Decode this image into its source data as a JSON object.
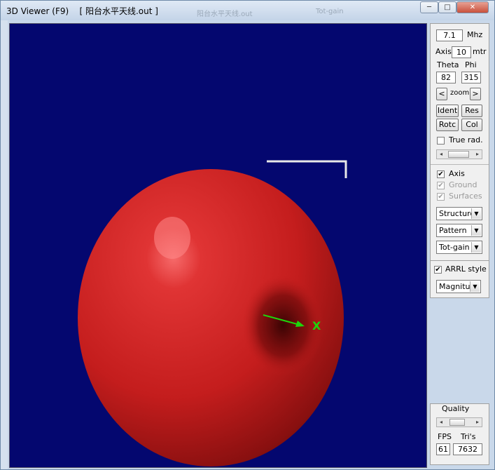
{
  "window": {
    "title": "3D Viewer (F9)    [ 阳台水平天线.out ]",
    "ghost_text_1": "阳台水平天线.out",
    "ghost_text_2": "Tot-gain",
    "minimize_label": "─",
    "maximize_label": "□",
    "close_label": "✕"
  },
  "controls": {
    "frequency_value": "7.1",
    "frequency_unit": "Mhz",
    "axis_label": "Axis",
    "axis_value": "10",
    "axis_unit": "mtr",
    "theta_label": "Theta",
    "phi_label": "Phi",
    "theta_value": "82",
    "phi_value": "315",
    "zoom_left": "<",
    "zoom_label": "zoom",
    "zoom_right": ">",
    "ident_label": "Ident",
    "res_label": "Res",
    "rotc_label": "Rotc",
    "col_label": "Col",
    "true_rad_label": "True rad.",
    "axis_check_label": "Axis",
    "ground_label": "Ground",
    "surfaces_label": "Surfaces",
    "structure_select": "Structure",
    "pattern_select": "Pattern",
    "gain_select": "Tot-gain",
    "arrl_label": "ARRL style",
    "magnitude_select": "Magnituc",
    "quality_label": "Quality",
    "fps_label": "FPS",
    "tris_label": "Tri's",
    "fps_value": "61",
    "tris_value": "7632"
  },
  "viewport": {
    "background": "#04076f",
    "pattern_color": "#c41d1d",
    "axis_label": "X",
    "axis_color": "#1ed60c"
  }
}
